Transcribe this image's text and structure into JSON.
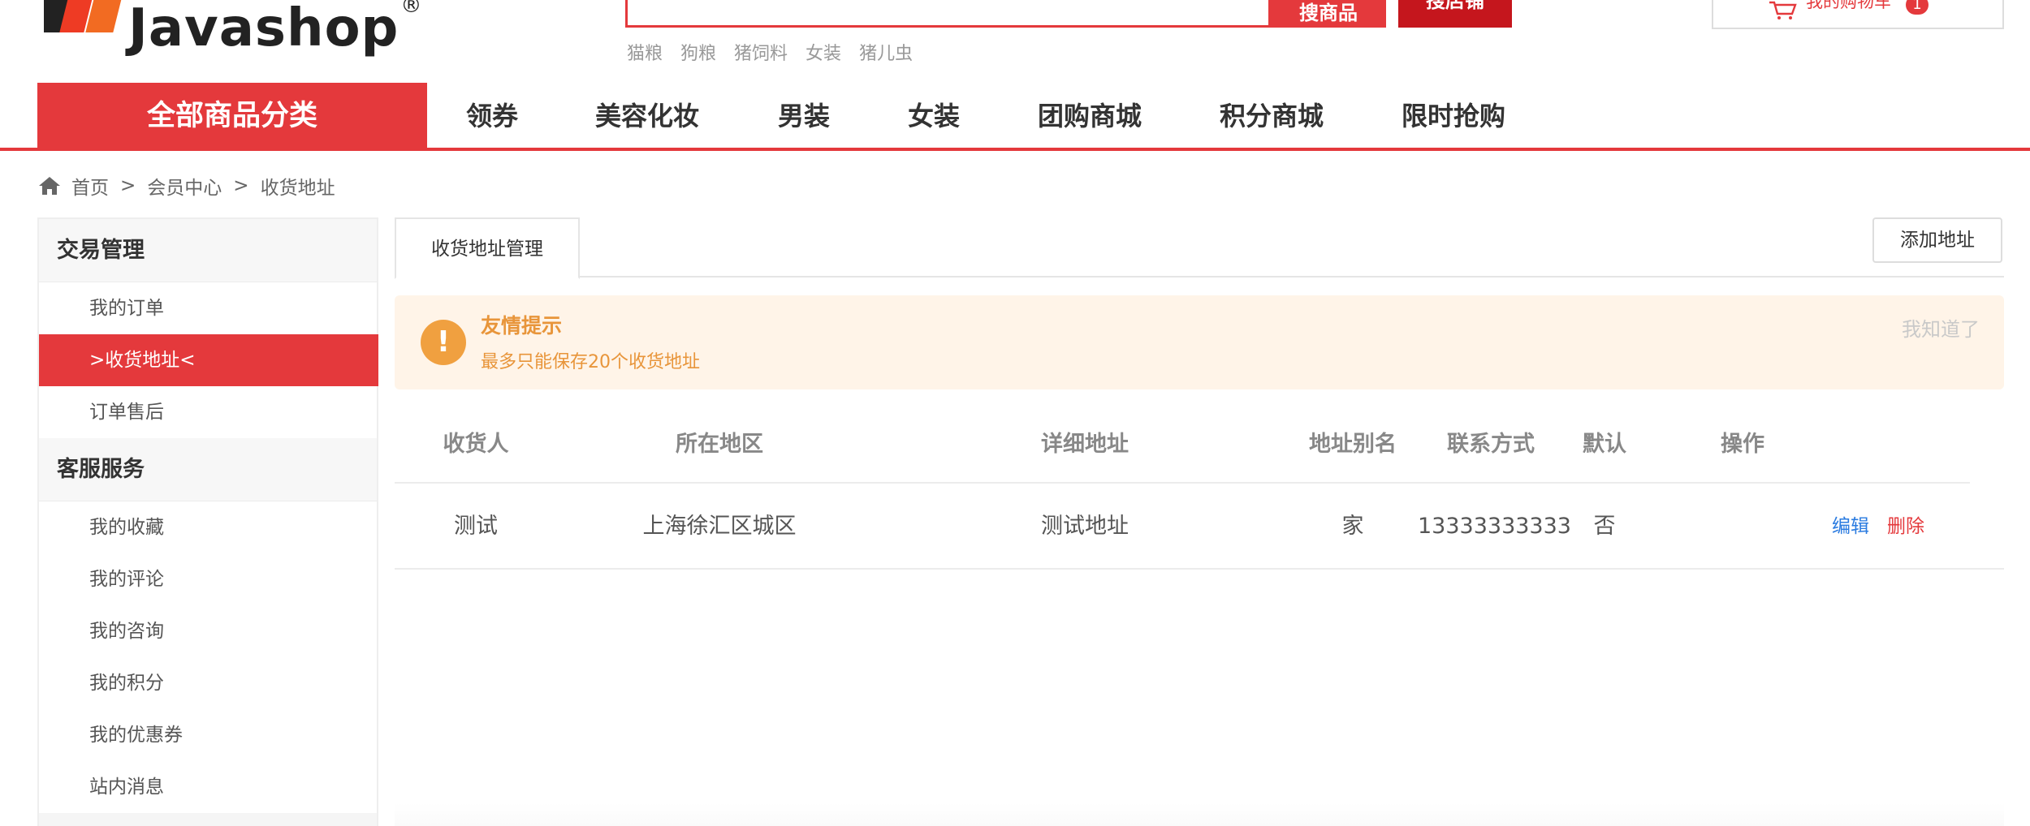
{
  "brand": {
    "logo_text": "Javashop",
    "logo_mark": "®"
  },
  "search": {
    "input_value": "",
    "btn_goods": "搜商品",
    "btn_shop": "搜店铺",
    "hot_words": [
      "猫粮",
      "狗粮",
      "猪饲料",
      "女装",
      "猪儿虫"
    ]
  },
  "cart": {
    "label": "我的购物车",
    "count": "1",
    "icon": "cart-icon"
  },
  "nav": {
    "category": "全部商品分类",
    "items": [
      "领券",
      "美容化妆",
      "男装",
      "女装",
      "团购商城",
      "积分商城",
      "限时抢购"
    ]
  },
  "breadcrumb": {
    "home": "首页",
    "sep": ">",
    "level2": "会员中心",
    "level3": "收货地址",
    "icon": "home-icon"
  },
  "sidebar": {
    "group1": {
      "title": "交易管理",
      "items": [
        "我的订单",
        ">收货地址<",
        "订单售后"
      ]
    },
    "group2": {
      "title": "客服服务",
      "items": [
        "我的收藏",
        "我的评论",
        "我的咨询",
        "我的积分",
        "我的优惠券",
        "站内消息"
      ]
    }
  },
  "main": {
    "tab_label": "收货地址管理",
    "add_button": "添加地址",
    "tip": {
      "icon": "exclamation-icon",
      "title": "友情提示",
      "text": "最多只能保存20个收货地址",
      "dismiss": "我知道了"
    },
    "table": {
      "headers": [
        "收货人",
        "所在地区",
        "详细地址",
        "地址别名",
        "联系方式",
        "默认",
        "操作"
      ],
      "rows": [
        {
          "name": "测试",
          "region": "上海徐汇区城区",
          "address": "测试地址",
          "alias": "家",
          "phone": "13333333333",
          "default": "否",
          "edit": "编辑",
          "delete": "删除"
        }
      ]
    }
  },
  "colors": {
    "accent": "#e4393c",
    "accent_dark": "#c5161d",
    "tip_bg": "#fff4e8",
    "tip_text": "#e8953a",
    "link_blue": "#2a7be0"
  }
}
